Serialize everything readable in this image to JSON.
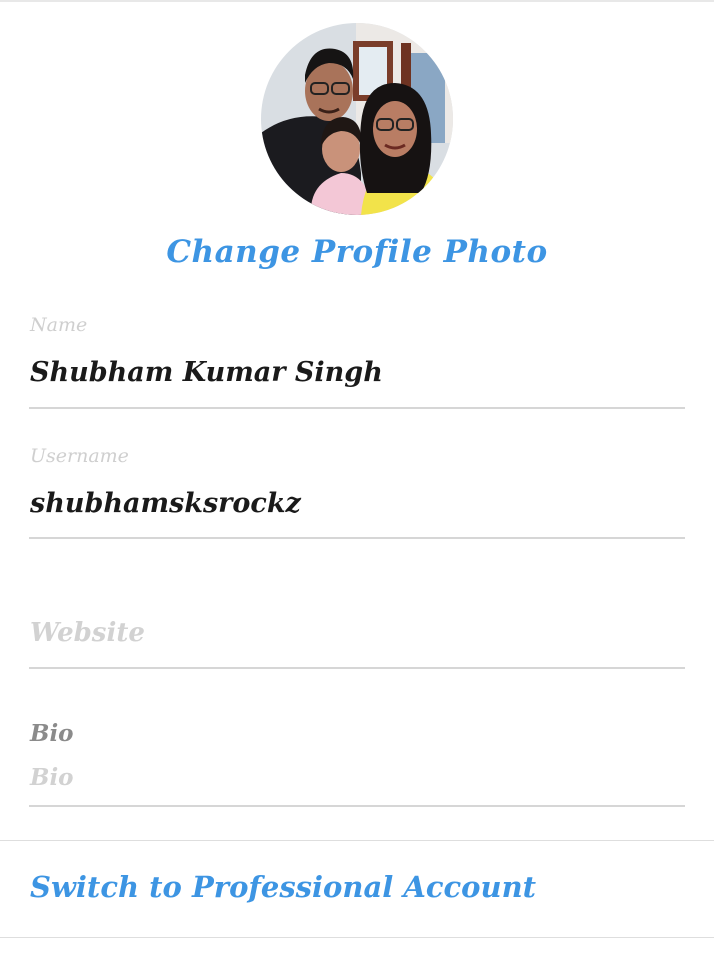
{
  "profile": {
    "change_photo_label": "Change Profile Photo"
  },
  "form": {
    "name": {
      "label": "Name",
      "value": "Shubham Kumar Singh"
    },
    "username": {
      "label": "Username",
      "value": "shubhamsksrockz"
    },
    "website": {
      "placeholder": "Website"
    },
    "bio": {
      "label": "Bio",
      "placeholder": "Bio"
    }
  },
  "footer": {
    "switch_label": "Switch to Professional Account"
  },
  "colors": {
    "accent": "#3d95e3",
    "text": "#1a1a1a",
    "muted": "#cfcfcf",
    "divider": "#d6d6d6"
  }
}
